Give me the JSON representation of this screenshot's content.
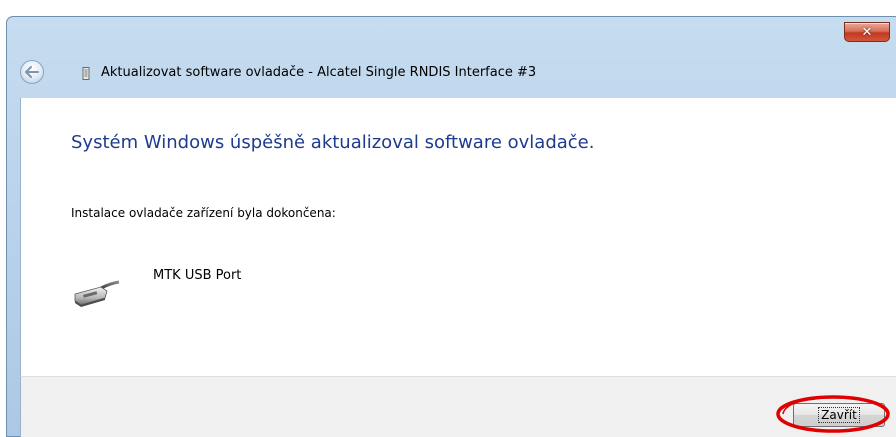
{
  "window": {
    "title": "Aktualizovat software ovladače - Alcatel Single RNDIS Interface #3",
    "close_glyph": "✕"
  },
  "content": {
    "heading": "Systém Windows úspěšně aktualizoval software ovladače.",
    "subtext": "Instalace ovladače zařízení byla dokončena:",
    "device": {
      "name": "MTK USB Port",
      "icon": "usb-cable-icon"
    }
  },
  "footer": {
    "close_label": "Zavřít"
  },
  "colors": {
    "heading": "#1e3b8f",
    "highlight": "#e00000",
    "close_button_red": "#c2391f"
  }
}
